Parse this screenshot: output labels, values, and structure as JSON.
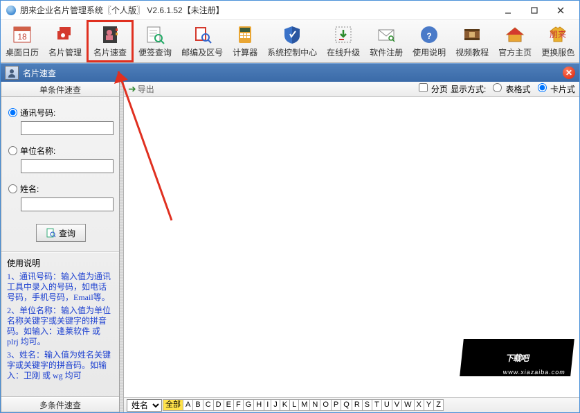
{
  "window": {
    "title": "朋来企业名片管理系统〖个人版〗  V2.6.1.52【未注册】"
  },
  "toolbar": [
    {
      "id": "desktop-calendar",
      "label": "桌面日历"
    },
    {
      "id": "card-manage",
      "label": "名片管理"
    },
    {
      "id": "card-quick-search",
      "label": "名片速查",
      "highlight": true
    },
    {
      "id": "note-search",
      "label": "便签查询"
    },
    {
      "id": "postal-area",
      "label": "邮编及区号"
    },
    {
      "id": "calculator",
      "label": "计算器"
    },
    {
      "id": "system-control",
      "label": "系统控制中心"
    },
    {
      "id": "online-upgrade",
      "label": "在线升级"
    },
    {
      "id": "software-register",
      "label": "软件注册"
    },
    {
      "id": "usage-guide",
      "label": "使用说明"
    },
    {
      "id": "video-tutorial",
      "label": "视频教程"
    },
    {
      "id": "official-site",
      "label": "官方主页"
    },
    {
      "id": "change-skin",
      "label": "更换服色"
    }
  ],
  "subwindow": {
    "title": "名片速查"
  },
  "sidebar": {
    "panel_single_title": "单条件速查",
    "radio_phone": "通讯号码:",
    "radio_company": "单位名称:",
    "radio_name": "姓名:",
    "query_label": "查询",
    "help_title": "使用说明",
    "help_p1": "1、通讯号码：输入值为通讯工具中录入的号码，如电话号码，手机号码，Email等。",
    "help_p2": "2、单位名称：输入值为单位名称关键字或关键字的拼音码。如输入：逢莱软件 或 plrj 均可。",
    "help_p3": "3、姓名：输入值为姓名关键字或关键字的拼音码。如输入：卫刚 或 wg 均可",
    "panel_multi_title": "多条件速查"
  },
  "content": {
    "export_label": "导出",
    "paging_label": "分页",
    "display_label": "显示方式:",
    "opt_table": "表格式",
    "opt_card": "卡片式",
    "filter_label": "姓名",
    "all_label": "全部",
    "letters": [
      "A",
      "B",
      "C",
      "D",
      "E",
      "F",
      "G",
      "H",
      "I",
      "J",
      "K",
      "L",
      "M",
      "N",
      "O",
      "P",
      "Q",
      "R",
      "S",
      "T",
      "U",
      "V",
      "W",
      "X",
      "Y",
      "Z"
    ]
  },
  "watermark": {
    "text": "下载吧",
    "url": "www.xiazaiba.com"
  }
}
